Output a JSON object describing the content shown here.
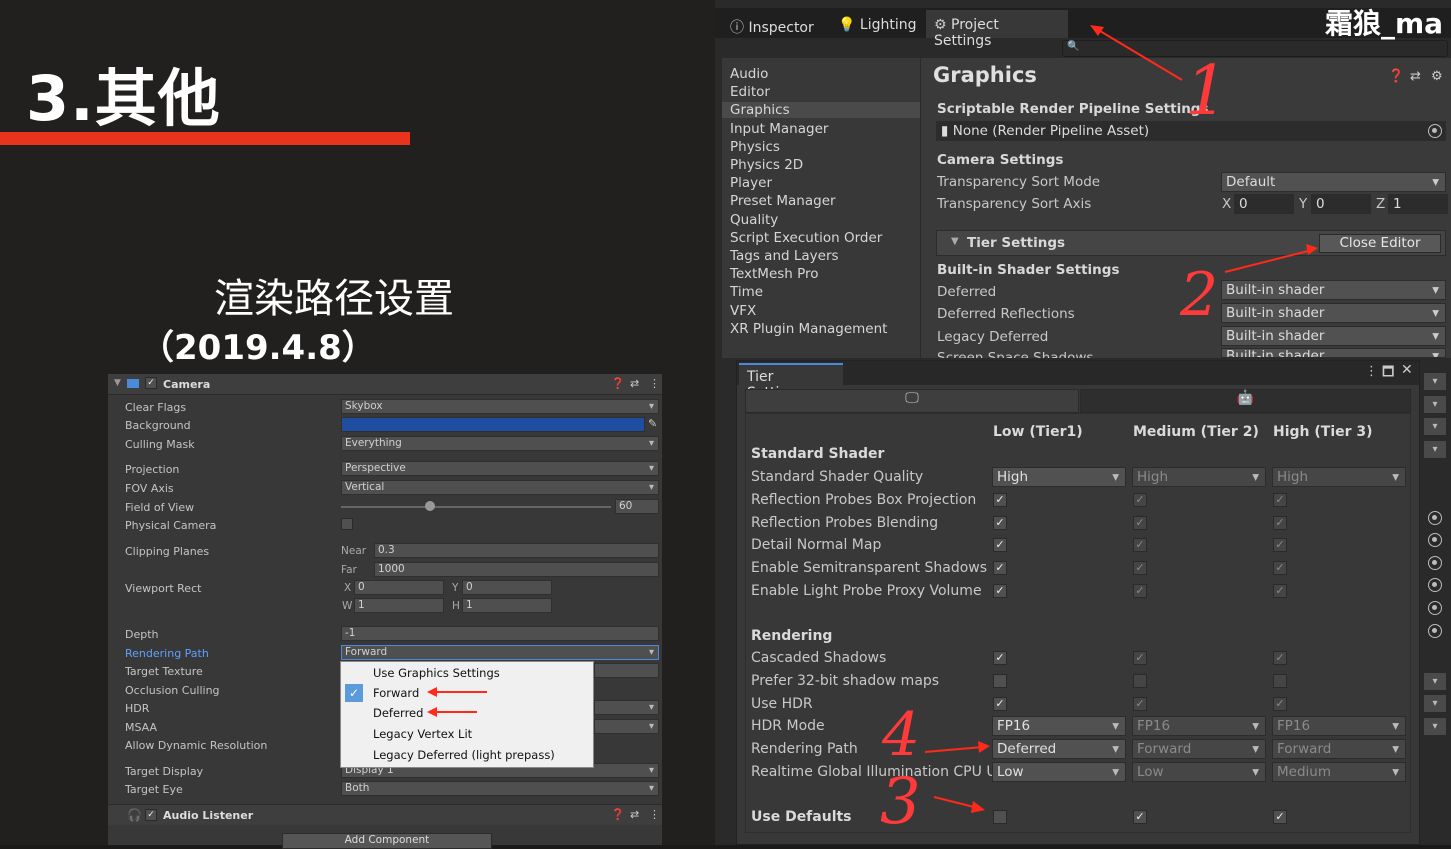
{
  "slide": {
    "title": "3.其他",
    "subtitle": "渲染路径设置",
    "version": "（2019.4.8）"
  },
  "camera": {
    "header": "Camera",
    "clear_flags_label": "Clear Flags",
    "clear_flags_value": "Skybox",
    "background_label": "Background",
    "culling_mask_label": "Culling Mask",
    "culling_mask_value": "Everything",
    "projection_label": "Projection",
    "projection_value": "Perspective",
    "fov_axis_label": "FOV Axis",
    "fov_axis_value": "Vertical",
    "fov_label": "Field of View",
    "fov_value": "60",
    "fov_slider_fraction": 0.33,
    "physical_camera_label": "Physical Camera",
    "clipping_label": "Clipping Planes",
    "near_label": "Near",
    "near_value": "0.3",
    "far_label": "Far",
    "far_value": "1000",
    "viewport_label": "Viewport Rect",
    "x_label": "X",
    "x_value": "0",
    "y_label": "Y",
    "y_value": "0",
    "w_label": "W",
    "w_value": "1",
    "h_label": "H",
    "h_value": "1",
    "depth_label": "Depth",
    "depth_value": "-1",
    "rendering_path_label": "Rendering Path",
    "rendering_path_value": "Forward",
    "target_texture_label": "Target Texture",
    "occlusion_label": "Occlusion Culling",
    "hdr_label": "HDR",
    "msaa_label": "MSAA",
    "dynres_label": "Allow Dynamic Resolution",
    "target_display_label": "Target Display",
    "target_display_value": "Display 1",
    "target_eye_label": "Target Eye",
    "target_eye_value": "Both",
    "audio_listener": "Audio Listener",
    "add_component": "Add Component",
    "menu_items": [
      "Use Graphics Settings",
      "Forward",
      "Deferred",
      "Legacy Vertex Lit",
      "Legacy Deferred (light prepass)"
    ],
    "menu_selected": "Forward"
  },
  "tabs": [
    "Inspector",
    "Lighting",
    "Project Settings"
  ],
  "watermark": "霜狼_ma",
  "sidebar": [
    "Audio",
    "Editor",
    "Graphics",
    "Input Manager",
    "Physics",
    "Physics 2D",
    "Player",
    "Preset Manager",
    "Quality",
    "Script Execution Order",
    "Tags and Layers",
    "TextMesh Pro",
    "Time",
    "VFX",
    "XR Plugin Management"
  ],
  "sidebar_selected": "Graphics",
  "graphics": {
    "title": "Graphics",
    "srp_header": "Scriptable Render Pipeline Settings",
    "srp_value": "None (Render Pipeline Asset)",
    "camera_header": "Camera Settings",
    "sort_mode_label": "Transparency Sort Mode",
    "sort_mode_value": "Default",
    "sort_axis_label": "Transparency Sort Axis",
    "axis_x_label": "X",
    "axis_x": "0",
    "axis_y_label": "Y",
    "axis_y": "0",
    "axis_z_label": "Z",
    "axis_z": "1",
    "tier_header": "Tier Settings",
    "close_editor": "Close Editor",
    "builtin_header": "Built-in Shader Settings",
    "deferred_label": "Deferred",
    "deferred_value": "Built-in shader",
    "deferred_refl_label": "Deferred Reflections",
    "deferred_refl_value": "Built-in shader",
    "legacy_deferred_label": "Legacy Deferred",
    "legacy_deferred_value": "Built-in shader",
    "ss_shadows_label": "Screen Space Shadows",
    "ss_shadows_value": "Built-in shader"
  },
  "tier": {
    "window_title": "Tier Settings",
    "columns": [
      "Low (Tier1)",
      "Medium (Tier 2)",
      "High (Tier 3)"
    ],
    "standard_shader_header": "Standard Shader",
    "quality_label": "Standard Shader Quality",
    "quality_values": [
      "High",
      "High",
      "High"
    ],
    "check_rows": [
      "Reflection Probes Box Projection",
      "Reflection Probes Blending",
      "Detail Normal Map",
      "Enable Semitransparent Shadows",
      "Enable Light Probe Proxy Volume"
    ],
    "rendering_header": "Rendering",
    "cascaded_label": "Cascaded Shadows",
    "prefer32_label": "Prefer 32-bit shadow maps",
    "use_hdr_label": "Use HDR",
    "hdr_mode_label": "HDR Mode",
    "hdr_mode_values": [
      "FP16",
      "FP16",
      "FP16"
    ],
    "rendering_path_label": "Rendering Path",
    "rendering_path_values": [
      "Deferred",
      "Forward",
      "Forward"
    ],
    "realtime_gi_label": "Realtime Global Illumination CPU Usa",
    "realtime_gi_values": [
      "Low",
      "Low",
      "Medium"
    ],
    "use_defaults_label": "Use Defaults"
  },
  "annotations": [
    "1",
    "2",
    "3",
    "4"
  ]
}
